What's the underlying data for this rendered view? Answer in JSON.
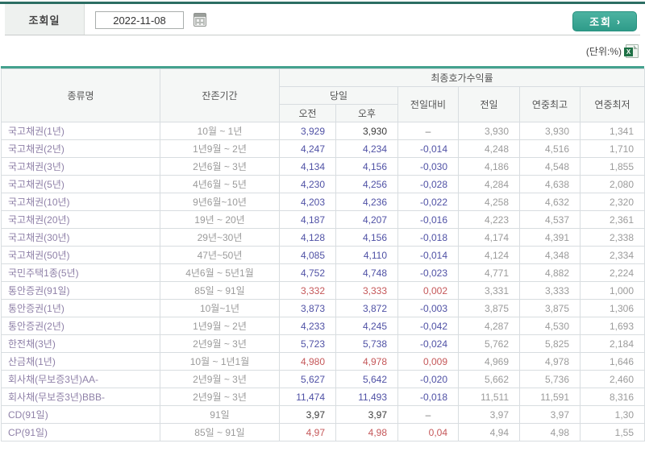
{
  "topbar": {
    "date_label": "조회일",
    "date_value": "2022-11-08",
    "search_button_label": "조회",
    "search_button_arrow": "›"
  },
  "unit_note": "(단위:%)",
  "colors": {
    "accent_teal": "#2f9c8a",
    "top_rule_teal": "#2c6e63",
    "table_rule_teal": "#44a18e",
    "value_down_blue": "#4f51a5",
    "value_up_red": "#c5585a",
    "value_flat_black": "#3a3a3a",
    "reference_gray": "#9b9b9b",
    "bond_name_purple": "#8f81a8"
  },
  "table": {
    "headers": {
      "col_type": "종류명",
      "col_period": "잔존기간",
      "group_yield": "최종호가수익률",
      "group_today": "당일",
      "am": "오전",
      "pm": "오후",
      "chg": "전일대비",
      "prev": "전일",
      "year_high": "연중최고",
      "year_low": "연중최저"
    },
    "rows": [
      {
        "name": "국고채권(1년)",
        "period": "10월 ~ 1년",
        "am": "3,929",
        "pm": "3,930",
        "chg": "–",
        "prev": "3,930",
        "high": "3,930",
        "low": "1,341",
        "am_c": "down",
        "pm_c": "flat",
        "chg_c": "flat"
      },
      {
        "name": "국고채권(2년)",
        "period": "1년9월 ~ 2년",
        "am": "4,247",
        "pm": "4,234",
        "chg": "-0,014",
        "prev": "4,248",
        "high": "4,516",
        "low": "1,710",
        "am_c": "down",
        "pm_c": "down",
        "chg_c": "down"
      },
      {
        "name": "국고채권(3년)",
        "period": "2년6월 ~ 3년",
        "am": "4,134",
        "pm": "4,156",
        "chg": "-0,030",
        "prev": "4,186",
        "high": "4,548",
        "low": "1,855",
        "am_c": "down",
        "pm_c": "down",
        "chg_c": "down"
      },
      {
        "name": "국고채권(5년)",
        "period": "4년6월 ~ 5년",
        "am": "4,230",
        "pm": "4,256",
        "chg": "-0,028",
        "prev": "4,284",
        "high": "4,638",
        "low": "2,080",
        "am_c": "down",
        "pm_c": "down",
        "chg_c": "down"
      },
      {
        "name": "국고채권(10년)",
        "period": "9년6월~10년",
        "am": "4,203",
        "pm": "4,236",
        "chg": "-0,022",
        "prev": "4,258",
        "high": "4,632",
        "low": "2,320",
        "am_c": "down",
        "pm_c": "down",
        "chg_c": "down"
      },
      {
        "name": "국고채권(20년)",
        "period": "19년 ~ 20년",
        "am": "4,187",
        "pm": "4,207",
        "chg": "-0,016",
        "prev": "4,223",
        "high": "4,537",
        "low": "2,361",
        "am_c": "down",
        "pm_c": "down",
        "chg_c": "down"
      },
      {
        "name": "국고채권(30년)",
        "period": "29년~30년",
        "am": "4,128",
        "pm": "4,156",
        "chg": "-0,018",
        "prev": "4,174",
        "high": "4,391",
        "low": "2,338",
        "am_c": "down",
        "pm_c": "down",
        "chg_c": "down"
      },
      {
        "name": "국고채권(50년)",
        "period": "47년~50년",
        "am": "4,085",
        "pm": "4,110",
        "chg": "-0,014",
        "prev": "4,124",
        "high": "4,348",
        "low": "2,334",
        "am_c": "down",
        "pm_c": "down",
        "chg_c": "down"
      },
      {
        "name": "국민주택1종(5년)",
        "period": "4년6월 ~ 5년1월",
        "am": "4,752",
        "pm": "4,748",
        "chg": "-0,023",
        "prev": "4,771",
        "high": "4,882",
        "low": "2,224",
        "am_c": "down",
        "pm_c": "down",
        "chg_c": "down"
      },
      {
        "name": "통안증권(91일)",
        "period": "85일 ~ 91일",
        "am": "3,332",
        "pm": "3,333",
        "chg": "0,002",
        "prev": "3,331",
        "high": "3,333",
        "low": "1,000",
        "am_c": "up",
        "pm_c": "up",
        "chg_c": "up"
      },
      {
        "name": "통안증권(1년)",
        "period": "10월~1년",
        "am": "3,873",
        "pm": "3,872",
        "chg": "-0,003",
        "prev": "3,875",
        "high": "3,875",
        "low": "1,306",
        "am_c": "down",
        "pm_c": "down",
        "chg_c": "down"
      },
      {
        "name": "통안증권(2년)",
        "period": "1년9월 ~ 2년",
        "am": "4,233",
        "pm": "4,245",
        "chg": "-0,042",
        "prev": "4,287",
        "high": "4,530",
        "low": "1,693",
        "am_c": "down",
        "pm_c": "down",
        "chg_c": "down"
      },
      {
        "name": "한전채(3년)",
        "period": "2년9월 ~ 3년",
        "am": "5,723",
        "pm": "5,738",
        "chg": "-0,024",
        "prev": "5,762",
        "high": "5,825",
        "low": "2,184",
        "am_c": "down",
        "pm_c": "down",
        "chg_c": "down"
      },
      {
        "name": "산금채(1년)",
        "period": "10월 ~ 1년1월",
        "am": "4,980",
        "pm": "4,978",
        "chg": "0,009",
        "prev": "4,969",
        "high": "4,978",
        "low": "1,646",
        "am_c": "up",
        "pm_c": "up",
        "chg_c": "up"
      },
      {
        "name": "회사채(무보증3년)AA-",
        "period": "2년9월 ~ 3년",
        "am": "5,627",
        "pm": "5,642",
        "chg": "-0,020",
        "prev": "5,662",
        "high": "5,736",
        "low": "2,460",
        "am_c": "down",
        "pm_c": "down",
        "chg_c": "down"
      },
      {
        "name": "회사채(무보증3년)BBB-",
        "period": "2년9월 ~ 3년",
        "am": "11,474",
        "pm": "11,493",
        "chg": "-0,018",
        "prev": "11,511",
        "high": "11,591",
        "low": "8,316",
        "am_c": "down",
        "pm_c": "down",
        "chg_c": "down"
      },
      {
        "name": "CD(91일)",
        "period": "91일",
        "am": "3,97",
        "pm": "3,97",
        "chg": "–",
        "prev": "3,97",
        "high": "3,97",
        "low": "1,30",
        "am_c": "flat",
        "pm_c": "flat",
        "chg_c": "flat"
      },
      {
        "name": "CP(91일)",
        "period": "85일 ~ 91일",
        "am": "4,97",
        "pm": "4,98",
        "chg": "0,04",
        "prev": "4,94",
        "high": "4,98",
        "low": "1,55",
        "am_c": "up",
        "pm_c": "up",
        "chg_c": "up"
      }
    ]
  }
}
